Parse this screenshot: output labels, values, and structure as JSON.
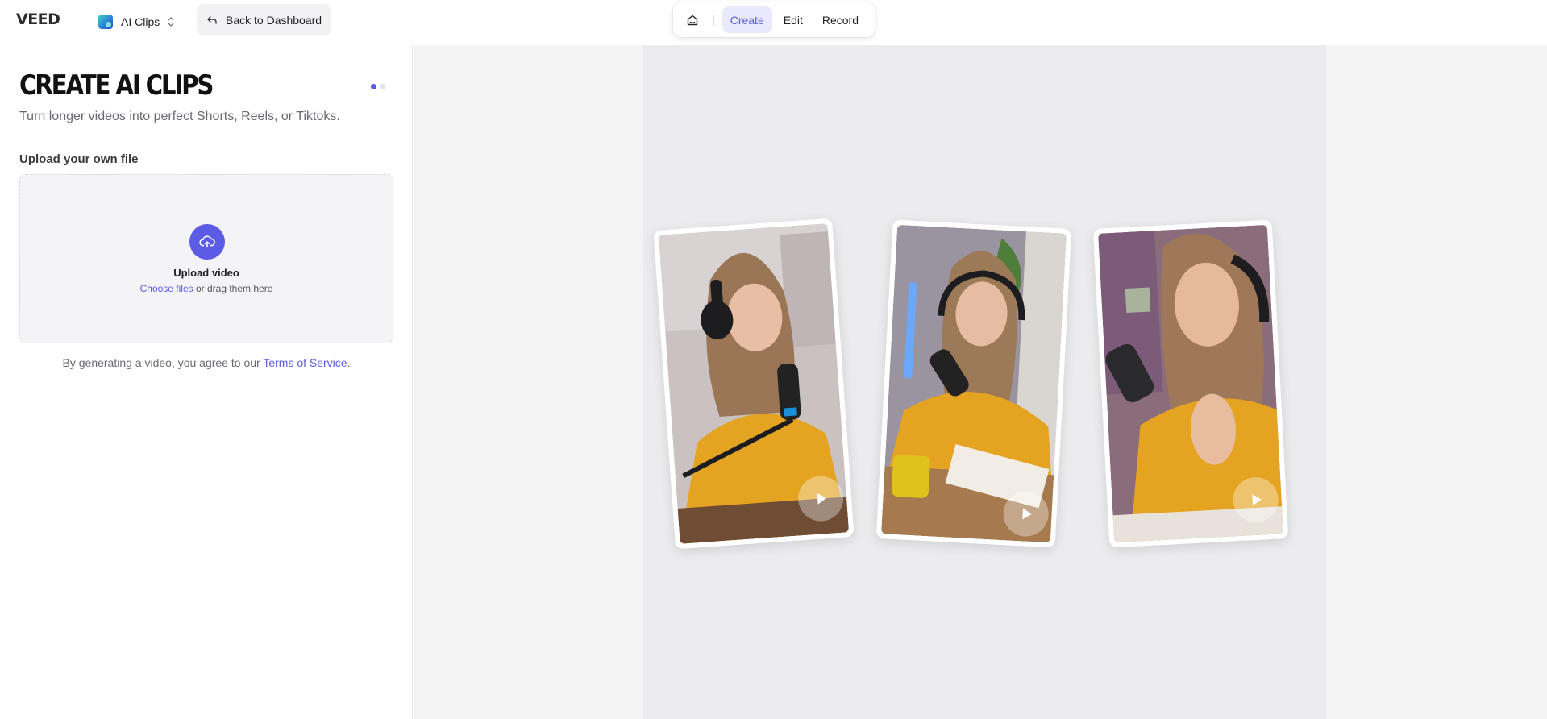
{
  "topbar": {
    "logo": "VEED",
    "app_name": "AI Clips",
    "back_label": "Back to Dashboard",
    "modes": [
      {
        "label": "Create",
        "active": true
      },
      {
        "label": "Edit",
        "active": false
      },
      {
        "label": "Record",
        "active": false
      }
    ]
  },
  "panel": {
    "title": "CREATE AI CLIPS",
    "subtitle": "Turn longer videos into perfect Shorts, Reels, or Tiktoks.",
    "section_label": "Upload your own file",
    "upload": {
      "title": "Upload video",
      "choose_link": "Choose files",
      "drag_text": " or drag them here"
    },
    "terms_prefix": "By generating a video, you agree to our ",
    "terms_link": "Terms of Service",
    "terms_suffix": "."
  },
  "preview": {
    "cards": [
      {
        "description_icon": "podcast-woman-headphones-photo"
      },
      {
        "description_icon": "podcast-woman-mic-notebook-photo"
      },
      {
        "description_icon": "podcast-woman-praying-hands-photo"
      }
    ]
  },
  "colors": {
    "accent": "#5b5be6",
    "accent_soft": "#e9e9fb",
    "stage_bg": "#ececee",
    "sweater": "#e4a321"
  }
}
